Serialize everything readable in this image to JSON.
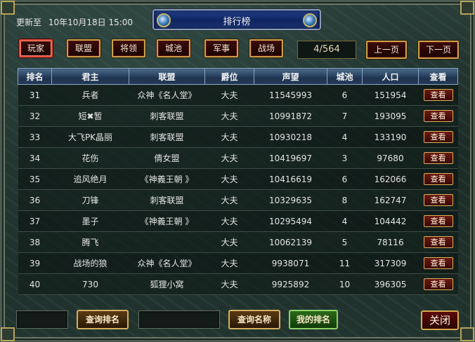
{
  "header": {
    "update_label": "更新至",
    "update_time": "10年10月18日 15:00",
    "title": "排行榜"
  },
  "tabs": [
    {
      "label": "玩家",
      "active": true
    },
    {
      "label": "联盟"
    },
    {
      "label": "将领"
    },
    {
      "label": "城池"
    },
    {
      "label": "军事"
    },
    {
      "label": "战场"
    }
  ],
  "pagination": {
    "current": "4/564",
    "prev_label": "上一页",
    "next_label": "下一页"
  },
  "table": {
    "columns": [
      "排名",
      "君主",
      "联盟",
      "爵位",
      "声望",
      "城池",
      "人口",
      "查看"
    ],
    "view_label": "查看",
    "rows": [
      {
        "rank": "31",
        "lord": "兵者",
        "alliance": "众神《名人堂》",
        "title": "大夫",
        "prestige": "11545993",
        "cities": "6",
        "population": "151954"
      },
      {
        "rank": "32",
        "lord": "短✖暂",
        "alliance": "刺客联盟",
        "title": "大夫",
        "prestige": "10991872",
        "cities": "7",
        "population": "193095"
      },
      {
        "rank": "33",
        "lord": "大飞PK晶丽",
        "alliance": "刺客联盟",
        "title": "大夫",
        "prestige": "10930218",
        "cities": "4",
        "population": "133190"
      },
      {
        "rank": "34",
        "lord": "花伤",
        "alliance": "倩女盟",
        "title": "大夫",
        "prestige": "10419697",
        "cities": "3",
        "population": "97680"
      },
      {
        "rank": "35",
        "lord": "追风绝月",
        "alliance": "《神義王朝 》",
        "title": "大夫",
        "prestige": "10416619",
        "cities": "6",
        "population": "162066"
      },
      {
        "rank": "36",
        "lord": "刀锋",
        "alliance": "刺客联盟",
        "title": "大夫",
        "prestige": "10329635",
        "cities": "8",
        "population": "162747"
      },
      {
        "rank": "37",
        "lord": "墨子",
        "alliance": "《神義王朝 》",
        "title": "大夫",
        "prestige": "10295494",
        "cities": "4",
        "population": "104442"
      },
      {
        "rank": "38",
        "lord": "腾飞",
        "alliance": "",
        "title": "大夫",
        "prestige": "10062139",
        "cities": "5",
        "population": "78116"
      },
      {
        "rank": "39",
        "lord": "战场的狼",
        "alliance": "众神《名人堂》",
        "title": "大夫",
        "prestige": "9938071",
        "cities": "11",
        "population": "317309"
      },
      {
        "rank": "40",
        "lord": "730",
        "alliance": "狐狸小窝",
        "title": "大夫",
        "prestige": "9925892",
        "cities": "10",
        "population": "396305"
      }
    ]
  },
  "footer": {
    "rank_input_value": "",
    "query_rank_label": "查询排名",
    "name_input_value": "",
    "query_name_label": "查询名称",
    "my_rank_label": "我的排名",
    "close_label": "关闭"
  },
  "colors": {
    "active_tab_border": "#e34a3a",
    "gold_border": "#c9a24a",
    "header_blue": "#1e3450",
    "green_button": "#2a6a1a"
  }
}
